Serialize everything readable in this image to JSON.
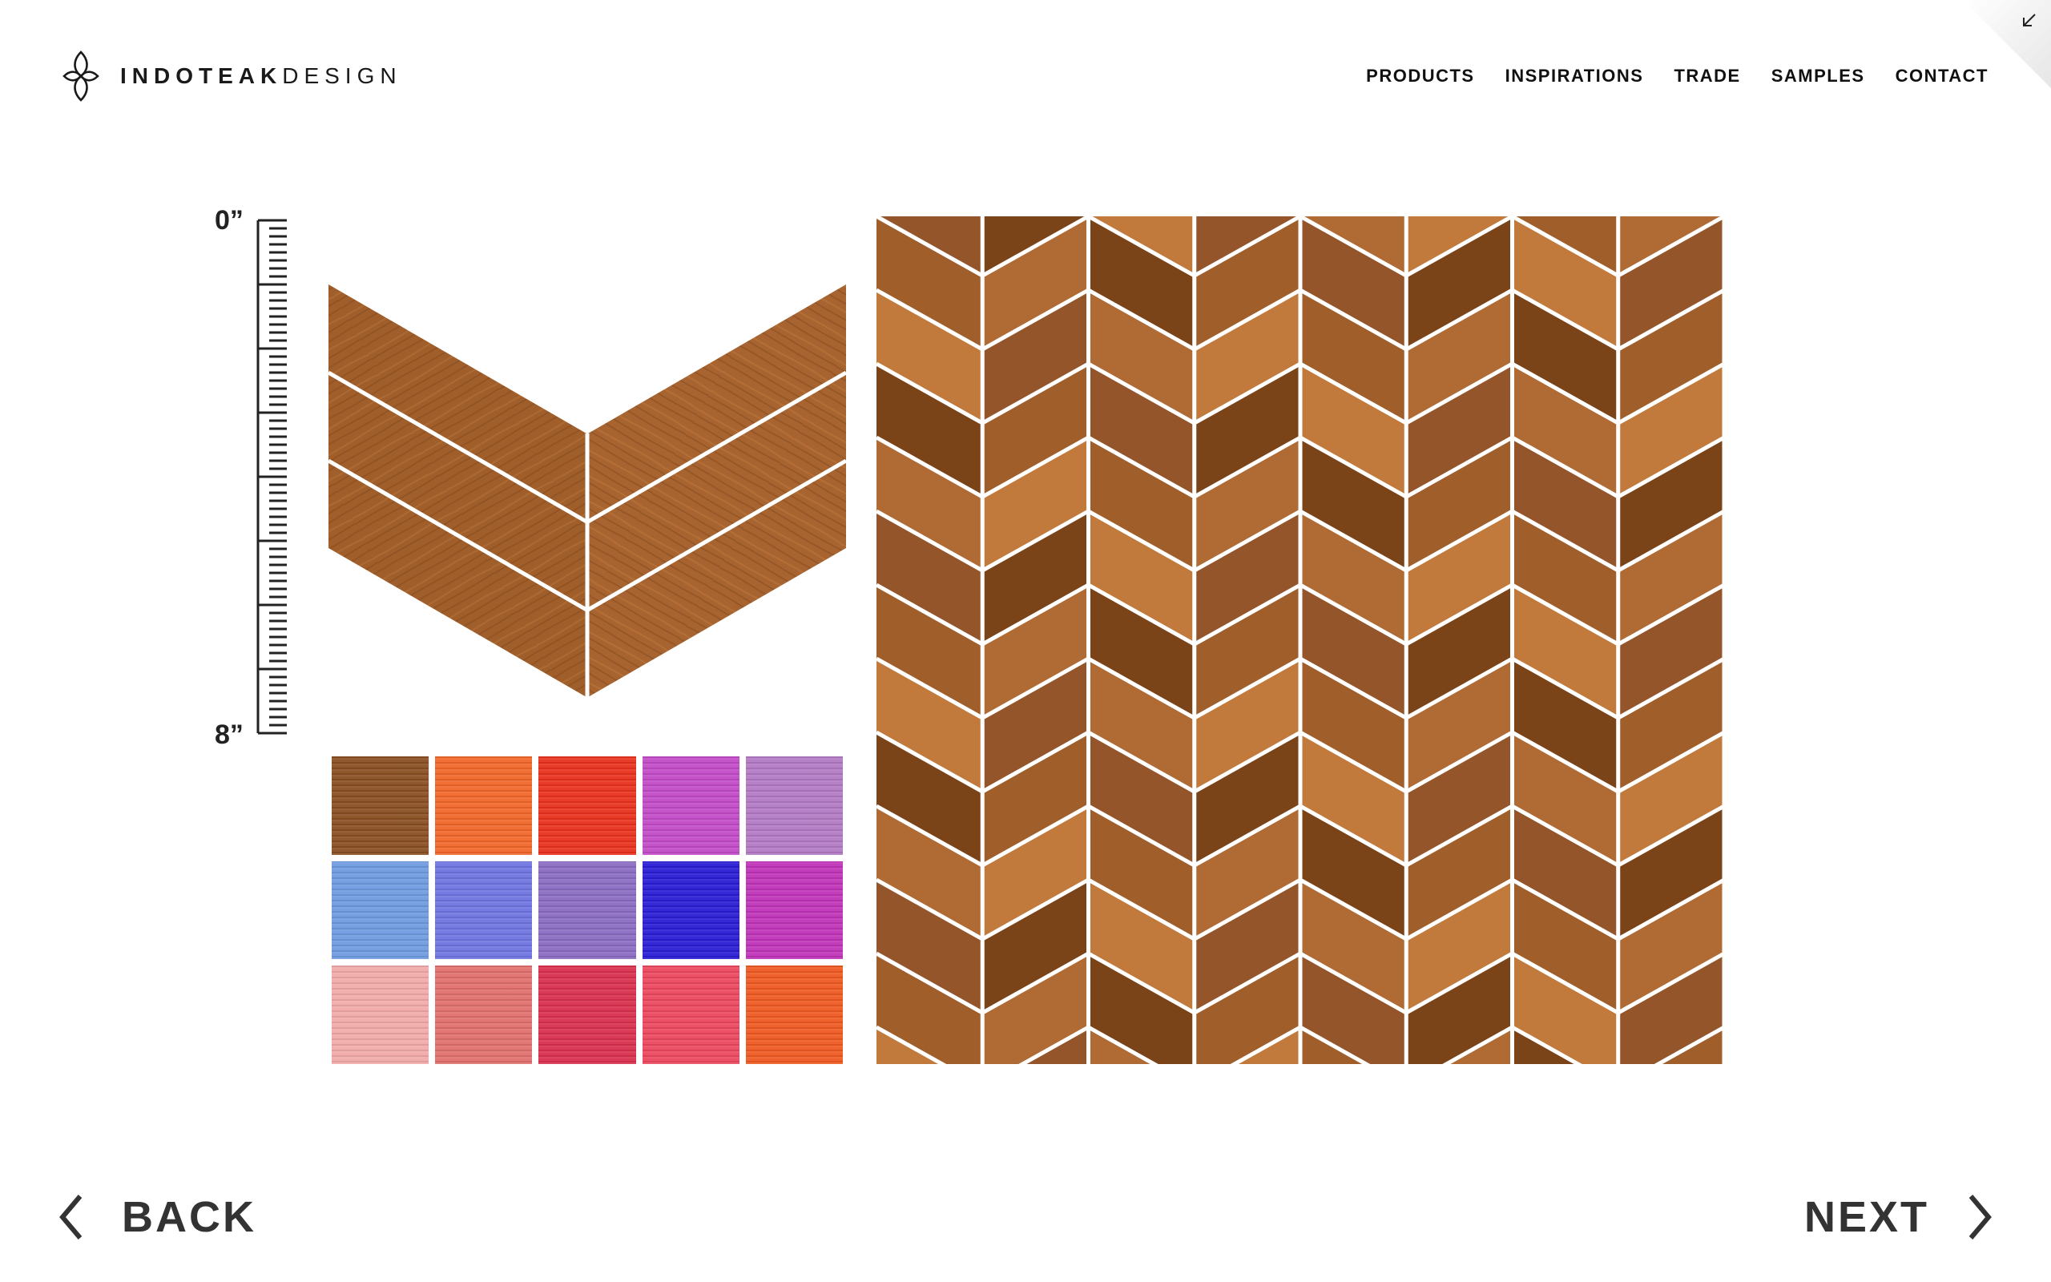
{
  "brand": {
    "name_bold": "INDOTEAK",
    "name_light": "DESIGN",
    "logo_icon": "quatrefoil-leaf-icon"
  },
  "nav": {
    "items": [
      "PRODUCTS",
      "INSPIRATIONS",
      "TRADE",
      "SAMPLES",
      "CONTACT"
    ]
  },
  "corner": {
    "icon": "collapse-arrow-icon"
  },
  "ruler": {
    "top_label": "0”",
    "bottom_label": "8”"
  },
  "colors": {
    "wood_base": "#a05e2b",
    "wood_light": "#c17a3c",
    "wood_dark": "#7a4318",
    "grout": "#ffffff"
  },
  "swatches": [
    {
      "color": "#8a4f22"
    },
    {
      "color": "#f0662a"
    },
    {
      "color": "#e8321d"
    },
    {
      "color": "#c24bc8"
    },
    {
      "color": "#b27ac4"
    },
    {
      "color": "#6f9be0"
    },
    {
      "color": "#6f74e0"
    },
    {
      "color": "#8a6cc2"
    },
    {
      "color": "#2a1dd4"
    },
    {
      "color": "#c034b8"
    },
    {
      "color": "#f0aaa8"
    },
    {
      "color": "#e0706e"
    },
    {
      "color": "#d8304e"
    },
    {
      "color": "#ec4860"
    },
    {
      "color": "#ee5a22"
    }
  ],
  "footer": {
    "back_label": "BACK",
    "next_label": "NEXT",
    "back_icon": "chevron-left-icon",
    "next_icon": "chevron-right-icon"
  }
}
